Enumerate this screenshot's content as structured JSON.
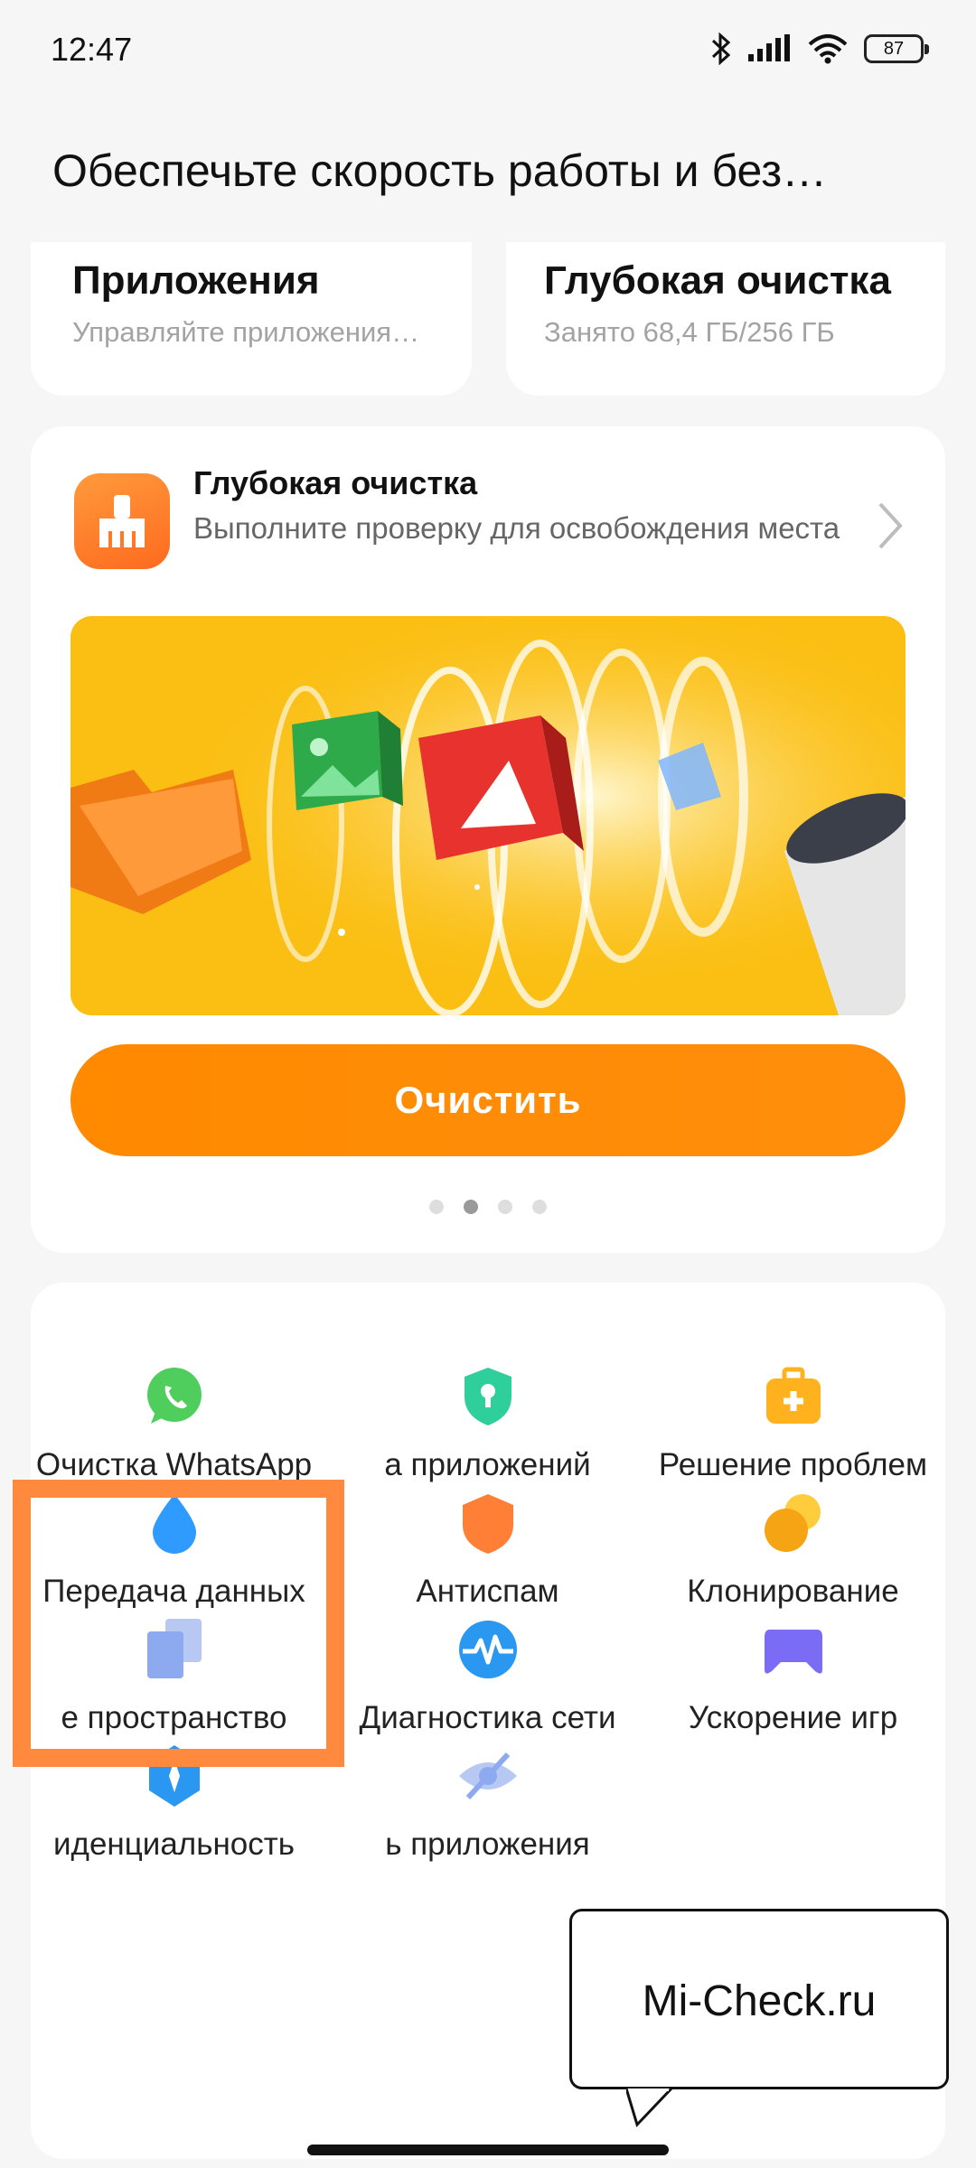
{
  "status_bar": {
    "time": "12:47",
    "battery": "87",
    "icons": [
      "bluetooth-icon",
      "signal-icon",
      "wifi-icon",
      "battery-icon"
    ]
  },
  "header": {
    "title": "Обеспечьте скорость работы и без…"
  },
  "top_cards": [
    {
      "title": "Приложения",
      "subtitle": "Управляйте приложения…"
    },
    {
      "title": "Глубокая очистка",
      "subtitle": "Занято 68,4 ГБ/256 ГБ"
    }
  ],
  "promo": {
    "title": "Глубокая очистка",
    "description": "Выполните проверку для освобождения места",
    "button_label": "Очистить",
    "page_count": 4,
    "active_page": 2
  },
  "tools": [
    {
      "label": "Очистка WhatsApp",
      "icon": "whatsapp-icon"
    },
    {
      "label": "а приложений",
      "icon": "shield-lock-icon"
    },
    {
      "label": "Решение проблем",
      "icon": "first-aid-kit-icon"
    },
    {
      "label": "Передача данных",
      "icon": "water-drop-icon"
    },
    {
      "label": "Антиспам",
      "icon": "shield-icon"
    },
    {
      "label": "Клонирование",
      "icon": "clone-circles-icon"
    },
    {
      "label": "е пространство",
      "icon": "dual-space-icon"
    },
    {
      "label": "Диагностика сети",
      "icon": "network-pulse-icon"
    },
    {
      "label": "Ускорение игр",
      "icon": "gamepad-icon"
    },
    {
      "label": "иденциальность",
      "icon": "privacy-diamond-icon"
    },
    {
      "label": "ь приложения",
      "icon": "hidden-eye-icon"
    }
  ],
  "watermark": {
    "text": "Mi-Check.ru"
  },
  "colors": {
    "accent_orange": "#ff8a00",
    "banner_yellow": "#fbbf13",
    "highlight": "#ff8a3d",
    "whatsapp_green": "#4fce5d",
    "teal": "#2ecf9a",
    "blue": "#2f9bff",
    "purple": "#7b6cf6"
  }
}
